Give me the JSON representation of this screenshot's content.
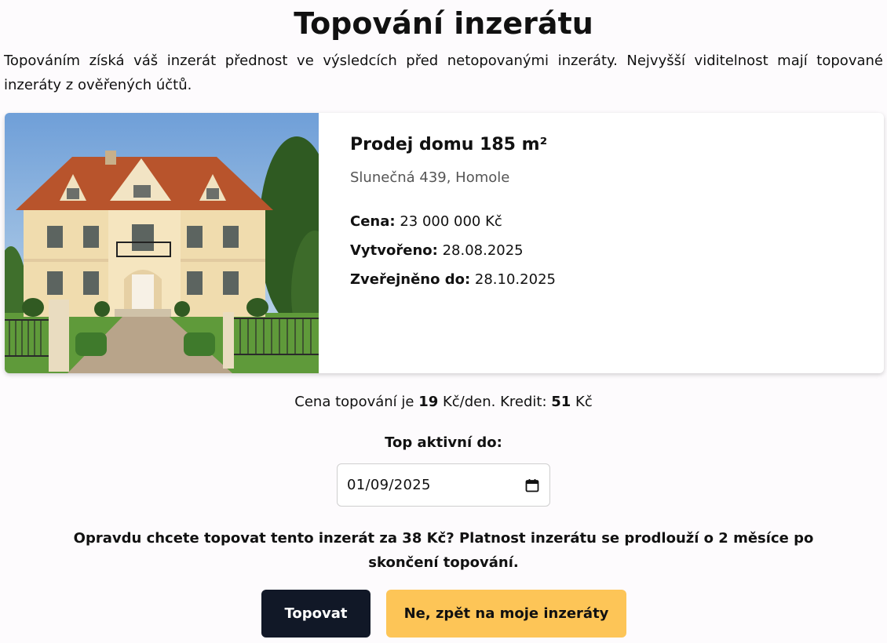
{
  "page": {
    "title": "Topování inzerátu",
    "intro": "Topováním získá váš inzerát přednost ve výsledcích před netopovanými inzeráty. Nejvyšší viditelnost mají topované inzeráty z ověřených účtů."
  },
  "listing": {
    "title": "Prodej domu 185 m²",
    "address": "Slunečná 439, Homole",
    "price_label": "Cena:",
    "price_value": "23 000 000 Kč",
    "created_label": "Vytvořeno:",
    "created_value": "28.08.2025",
    "published_label": "Zveřejněno do:",
    "published_value": "28.10.2025"
  },
  "topping": {
    "price_prefix": "Cena topování je ",
    "price_per_day": "19",
    "price_suffix": " Kč/den. Kredit: ",
    "credit": "51",
    "credit_suffix": " Kč",
    "active_until_label": "Top aktivní do:",
    "date_value": "01/09/2025",
    "confirm_prefix": "Opravdu chcete topovat tento inzerát za ",
    "confirm_amount": "38",
    "confirm_suffix": " Kč? Platnost inzerátu se prodlouží o 2 měsíce po skončení topování."
  },
  "buttons": {
    "confirm_label": "Topovat",
    "back_label": "Ne, zpět na moje inzeráty"
  },
  "colors": {
    "primary_button": "#111827",
    "secondary_button": "#fdc557"
  }
}
